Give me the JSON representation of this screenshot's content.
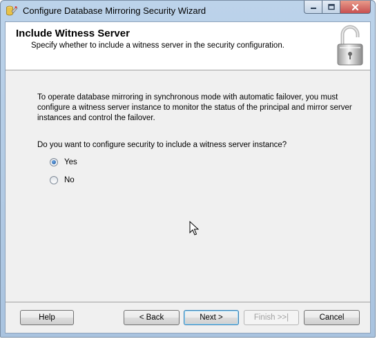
{
  "window": {
    "title": "Configure Database Mirroring Security Wizard",
    "icon": "database-wizard-icon",
    "controls": [
      "minimize-icon",
      "maximize-icon",
      "close-icon"
    ]
  },
  "header": {
    "title": "Include Witness Server",
    "subtitle": "Specify whether to include a witness server in the security configuration.",
    "graphic": "padlock-icon"
  },
  "content": {
    "description": "To operate database mirroring in synchronous mode with automatic failover, you must configure a witness server instance to monitor the status of the principal and mirror server instances and control the failover.",
    "question": "Do you want to configure security to include a witness server instance?",
    "options": [
      {
        "label": "Yes",
        "selected": true
      },
      {
        "label": "No",
        "selected": false
      }
    ]
  },
  "buttons": {
    "help": "Help",
    "back": "< Back",
    "next": "Next >",
    "finish": "Finish >>|",
    "cancel": "Cancel"
  },
  "colors": {
    "accent": "#3c7fb1",
    "window_frame": "#a9c3df",
    "dialog_background": "#f0f0f0",
    "close_button": "#c75050"
  }
}
